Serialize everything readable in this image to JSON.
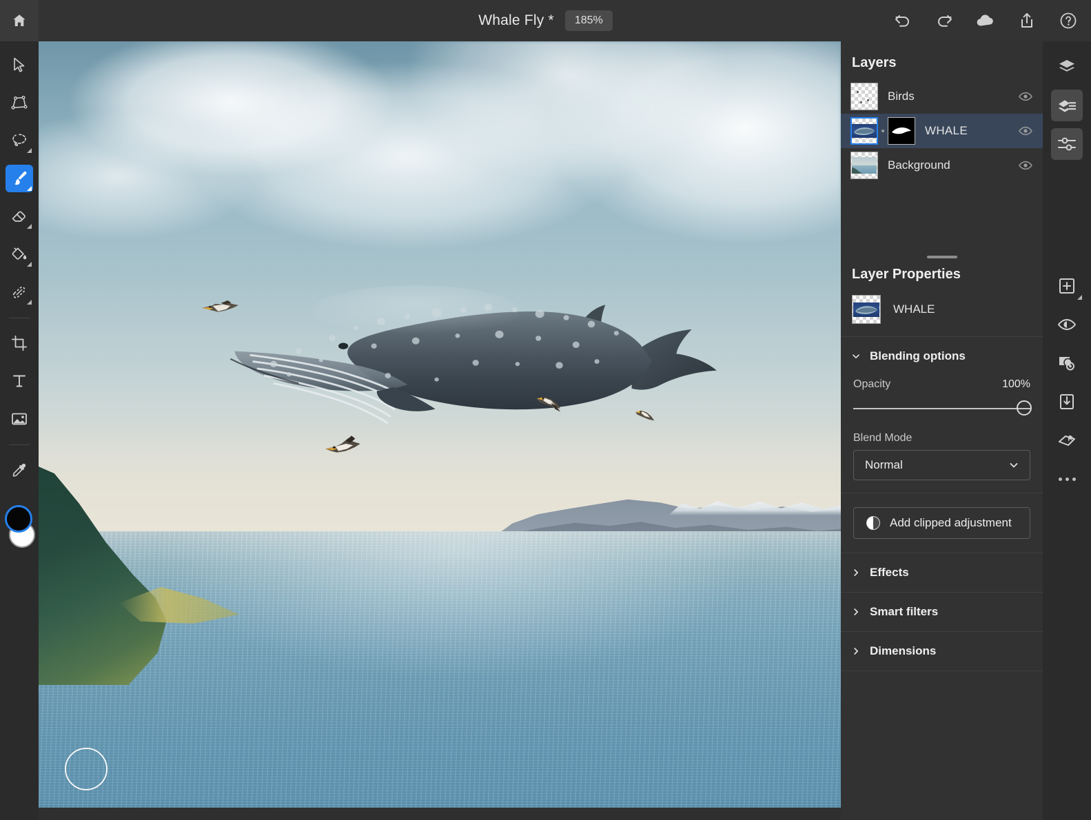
{
  "app": {
    "home_icon": "home-icon"
  },
  "topbar": {
    "document_title": "Whale Fly *",
    "zoom_level": "185%",
    "actions": [
      {
        "name": "undo-icon",
        "label": "Undo"
      },
      {
        "name": "redo-icon",
        "label": "Redo"
      },
      {
        "name": "cloud-icon",
        "label": "Cloud sync"
      },
      {
        "name": "share-icon",
        "label": "Share"
      },
      {
        "name": "help-icon",
        "label": "Help"
      }
    ]
  },
  "left_toolbar": {
    "tools": [
      {
        "name": "move-select-tool",
        "label": "Move",
        "active": false,
        "has_flyout": false
      },
      {
        "name": "transform-tool",
        "label": "Transform",
        "active": false,
        "has_flyout": false
      },
      {
        "name": "lasso-select-tool",
        "label": "Lasso select",
        "active": false,
        "has_flyout": true
      },
      {
        "name": "brush-tool",
        "label": "Brush",
        "active": true,
        "has_flyout": true
      },
      {
        "name": "eraser-tool",
        "label": "Eraser",
        "active": false,
        "has_flyout": true
      },
      {
        "name": "fill-tool",
        "label": "Fill",
        "active": false,
        "has_flyout": true
      },
      {
        "name": "healing-brush-tool",
        "label": "Healing brush",
        "active": false,
        "has_flyout": true
      },
      {
        "name": "crop-tool",
        "label": "Crop",
        "active": false,
        "has_flyout": false
      },
      {
        "name": "type-tool",
        "label": "Type",
        "active": false,
        "has_flyout": false
      },
      {
        "name": "place-image-tool",
        "label": "Place image",
        "active": false,
        "has_flyout": false
      },
      {
        "name": "eyedropper-tool",
        "label": "Eyedropper",
        "active": false,
        "has_flyout": false
      }
    ],
    "foreground_color": "#060606",
    "background_color": "#ffffff",
    "selection_color": "#2680eb"
  },
  "canvas": {
    "brush_cursor": "brush-cursor",
    "artwork_title": "Whale Fly composite"
  },
  "layers_panel": {
    "title": "Layers",
    "items": [
      {
        "name": "Birds",
        "visible": true,
        "selected": false,
        "has_mask": false,
        "thumb": "transparent-birds-thumb"
      },
      {
        "name": "WHALE",
        "visible": true,
        "selected": true,
        "has_mask": true,
        "thumb": "whale-thumb",
        "mask_thumb": "whale-mask-thumb"
      },
      {
        "name": "Background",
        "visible": true,
        "selected": false,
        "has_mask": false,
        "thumb": "background-thumb"
      }
    ]
  },
  "layer_properties": {
    "title": "Layer Properties",
    "layer_name": "WHALE",
    "blending": {
      "section_label": "Blending options",
      "expanded": true,
      "opacity_label": "Opacity",
      "opacity_value": "100%",
      "opacity_percent": 100,
      "blend_mode_label": "Blend Mode",
      "blend_mode_value": "Normal"
    },
    "add_clipped_adjustment_label": "Add clipped adjustment",
    "sections": [
      {
        "label": "Effects",
        "expanded": false
      },
      {
        "label": "Smart filters",
        "expanded": false
      },
      {
        "label": "Dimensions",
        "expanded": false
      }
    ]
  },
  "right_rail": {
    "buttons": [
      {
        "name": "layers-panel-icon",
        "label": "Layers",
        "active": false,
        "has_flyout": false
      },
      {
        "name": "layer-properties-icon",
        "label": "Layer properties",
        "active": true,
        "has_flyout": false
      },
      {
        "name": "adjustments-icon",
        "label": "Adjustments",
        "active": true,
        "has_flyout": false
      },
      {
        "name": "add-layer-icon",
        "label": "Add layer",
        "active": false,
        "has_flyout": true
      },
      {
        "name": "mask-visibility-icon",
        "label": "Layer mask",
        "active": false,
        "has_flyout": false
      },
      {
        "name": "select-subject-icon",
        "label": "Select subject",
        "active": false,
        "has_flyout": false
      },
      {
        "name": "clipping-mask-icon",
        "label": "Clipping mask",
        "active": false,
        "has_flyout": false
      },
      {
        "name": "transform-layer-icon",
        "label": "Transform",
        "active": false,
        "has_flyout": false
      },
      {
        "name": "more-options-icon",
        "label": "More options",
        "active": false,
        "has_flyout": false
      }
    ]
  },
  "colors": {
    "accent": "#2680eb",
    "panel_bg": "#323232",
    "toolbar_bg": "#2b2b2b",
    "topbar_bg": "#333333",
    "selected_layer_bg": "#39465a"
  }
}
